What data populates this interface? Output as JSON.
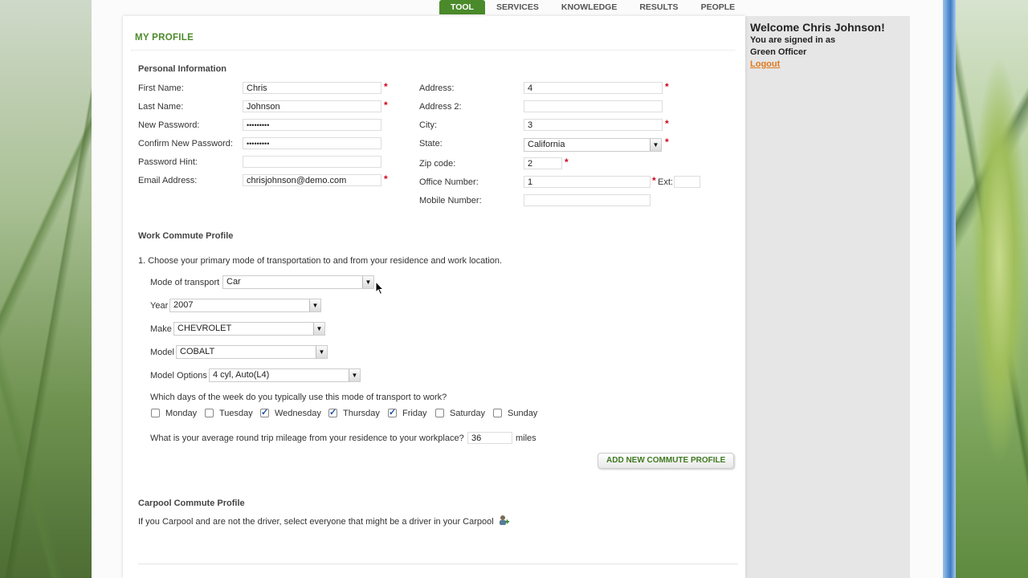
{
  "nav": {
    "tabs": [
      {
        "label": "TOOL",
        "active": true
      },
      {
        "label": "SERVICES",
        "active": false
      },
      {
        "label": "KNOWLEDGE",
        "active": false
      },
      {
        "label": "RESULTS",
        "active": false
      },
      {
        "label": "PEOPLE",
        "active": false
      }
    ]
  },
  "sidebar": {
    "welcome": "Welcome Chris Johnson!",
    "signed_in": "You are signed in as",
    "role": "Green Officer",
    "logout": "Logout"
  },
  "page": {
    "title": "MY PROFILE"
  },
  "personal": {
    "heading": "Personal Information",
    "first_name_label": "First Name:",
    "first_name": "Chris",
    "last_name_label": "Last Name:",
    "last_name": "Johnson",
    "new_password_label": "New Password:",
    "new_password": "•••••••••",
    "confirm_password_label": "Confirm New Password:",
    "confirm_password": "•••••••••",
    "hint_label": "Password Hint:",
    "hint": "",
    "email_label": "Email Address:",
    "email": "chrisjohnson@demo.com",
    "address_label": "Address:",
    "address": "4",
    "address2_label": "Address 2:",
    "address2": "",
    "city_label": "City:",
    "city": "3",
    "state_label": "State:",
    "state": "California",
    "zip_label": "Zip code:",
    "zip": "2",
    "office_label": "Office Number:",
    "office": "1",
    "ext_label": "Ext:",
    "ext": "",
    "mobile_label": "Mobile Number:",
    "mobile": "",
    "required_mark": "*"
  },
  "commute": {
    "heading": "Work Commute Profile",
    "question1": "1. Choose your primary mode of transportation to and from your residence and work location.",
    "mode_label": "Mode of transport",
    "mode": "Car",
    "year_label": "Year",
    "year": "2007",
    "make_label": "Make",
    "make": "CHEVROLET",
    "model_label": "Model",
    "model": "COBALT",
    "options_label": "Model Options",
    "options": "4 cyl, Auto(L4)",
    "days_question": "Which days of the week do you typically use this mode of transport to work?",
    "days": [
      {
        "label": "Monday",
        "checked": false
      },
      {
        "label": "Tuesday",
        "checked": false
      },
      {
        "label": "Wednesday",
        "checked": true
      },
      {
        "label": "Thursday",
        "checked": true
      },
      {
        "label": "Friday",
        "checked": true
      },
      {
        "label": "Saturday",
        "checked": false
      },
      {
        "label": "Sunday",
        "checked": false
      }
    ],
    "mileage_question": "What is your average round trip mileage from your residence to your workplace?",
    "mileage": "36",
    "mileage_unit": "miles",
    "add_button": "ADD NEW COMMUTE PROFILE",
    "check_glyph": "✓",
    "arrow_glyph": "▼"
  },
  "carpool": {
    "heading": "Carpool Commute Profile",
    "text": "If you Carpool and are not the driver, select everyone that might be a driver in your Carpool"
  }
}
